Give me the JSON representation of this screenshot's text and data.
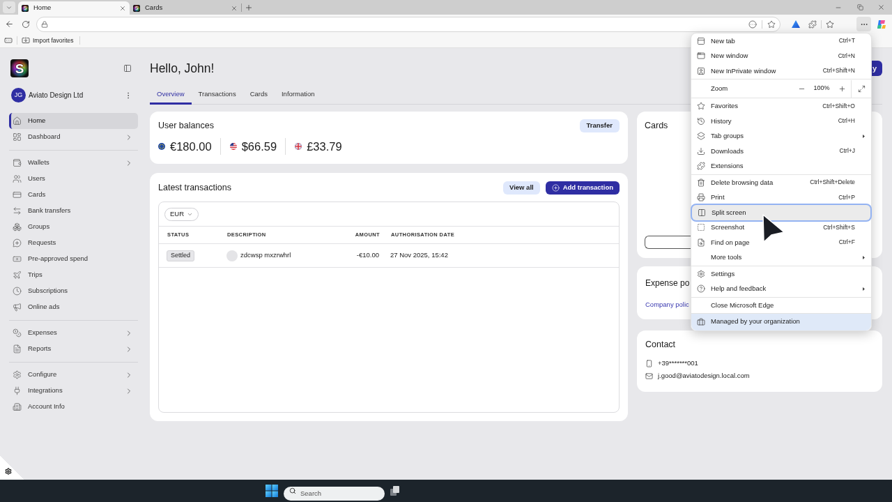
{
  "browser": {
    "tabs": [
      {
        "icon_text": "S",
        "title": "Home",
        "selected": true
      },
      {
        "icon_text": "S",
        "title": "Cards",
        "selected": false
      }
    ],
    "favorites_bar": {
      "items": [
        {
          "label": "Import favorites"
        }
      ]
    },
    "menu": {
      "groups": [
        {
          "items": [
            {
              "kind": "command",
              "label": "New tab",
              "shortcut": "Ctrl+T",
              "submenu": false,
              "highlighted": false
            },
            {
              "kind": "command",
              "label": "New window",
              "shortcut": "Ctrl+N",
              "submenu": false,
              "highlighted": false
            },
            {
              "kind": "command",
              "label": "New InPrivate window",
              "shortcut": "Ctrl+Shift+N",
              "submenu": false,
              "highlighted": false
            }
          ]
        },
        {
          "items": [
            {
              "kind": "zoom",
              "label": "Zoom",
              "value": "100%"
            }
          ]
        },
        {
          "items": [
            {
              "kind": "command",
              "label": "Favorites",
              "shortcut": "Ctrl+Shift+O",
              "submenu": false,
              "highlighted": false
            },
            {
              "kind": "command",
              "label": "History",
              "shortcut": "Ctrl+H",
              "submenu": false,
              "highlighted": false
            },
            {
              "kind": "command",
              "label": "Tab groups",
              "submenu": true,
              "highlighted": false
            },
            {
              "kind": "command",
              "label": "Downloads",
              "shortcut": "Ctrl+J",
              "submenu": false,
              "highlighted": false
            },
            {
              "kind": "command",
              "label": "Extensions",
              "submenu": false,
              "highlighted": false
            }
          ]
        },
        {
          "items": [
            {
              "kind": "command",
              "label": "Delete browsing data",
              "shortcut": "Ctrl+Shift+Delete",
              "submenu": false,
              "highlighted": false
            },
            {
              "kind": "command",
              "label": "Print",
              "shortcut": "Ctrl+P",
              "submenu": false,
              "highlighted": false
            },
            {
              "kind": "command",
              "label": "Split screen",
              "submenu": false,
              "highlighted": true
            },
            {
              "kind": "command",
              "label": "Screenshot",
              "shortcut": "Ctrl+Shift+S",
              "submenu": false,
              "highlighted": false
            },
            {
              "kind": "command",
              "label": "Find on page",
              "shortcut": "Ctrl+F",
              "submenu": false,
              "highlighted": false
            },
            {
              "kind": "command",
              "label": "More tools",
              "submenu": true,
              "highlighted": false
            }
          ]
        },
        {
          "items": [
            {
              "kind": "command",
              "label": "Settings",
              "submenu": false,
              "highlighted": false
            },
            {
              "kind": "command",
              "label": "Help and feedback",
              "submenu": true,
              "highlighted": false
            }
          ]
        },
        {
          "items": [
            {
              "kind": "command",
              "label": "Close Microsoft Edge",
              "submenu": false,
              "highlighted": false
            }
          ]
        },
        {
          "items": [
            {
              "kind": "banner",
              "label": "Managed by your organization"
            }
          ]
        }
      ]
    }
  },
  "sidebar": {
    "logo_text": "S",
    "organization": {
      "initials": "JG",
      "name": "Aviato Design Ltd"
    },
    "groups": [
      {
        "items": [
          {
            "label": "Home",
            "selected": true,
            "has_submenu": false
          },
          {
            "label": "Dashboard",
            "selected": false,
            "has_submenu": true
          }
        ]
      },
      {
        "items": [
          {
            "label": "Wallets",
            "selected": false,
            "has_submenu": true
          },
          {
            "label": "Users",
            "selected": false,
            "has_submenu": false
          },
          {
            "label": "Cards",
            "selected": false,
            "has_submenu": false
          },
          {
            "label": "Bank transfers",
            "selected": false,
            "has_submenu": false
          },
          {
            "label": "Groups",
            "selected": false,
            "has_submenu": false
          },
          {
            "label": "Requests",
            "selected": false,
            "has_submenu": false
          },
          {
            "label": "Pre-approved spend",
            "selected": false,
            "has_submenu": false
          },
          {
            "label": "Trips",
            "selected": false,
            "has_submenu": false
          },
          {
            "label": "Subscriptions",
            "selected": false,
            "has_submenu": false
          },
          {
            "label": "Online ads",
            "selected": false,
            "has_submenu": false
          }
        ]
      },
      {
        "items": [
          {
            "label": "Expenses",
            "selected": false,
            "has_submenu": true
          },
          {
            "label": "Reports",
            "selected": false,
            "has_submenu": true
          }
        ]
      },
      {
        "items": [
          {
            "label": "Configure",
            "selected": false,
            "has_submenu": true
          },
          {
            "label": "Integrations",
            "selected": false,
            "has_submenu": true
          },
          {
            "label": "Account Info",
            "selected": false,
            "has_submenu": false
          }
        ]
      }
    ]
  },
  "header": {
    "title": "Hello, John!",
    "action_button": "y"
  },
  "tabs": [
    {
      "label": "Overview",
      "selected": true
    },
    {
      "label": "Transactions",
      "selected": false
    },
    {
      "label": "Cards",
      "selected": false
    },
    {
      "label": "Information",
      "selected": false
    }
  ],
  "balances": {
    "title": "User balances",
    "button": "Transfer",
    "items": [
      {
        "amount": "€180.00"
      },
      {
        "amount": "$66.59"
      },
      {
        "amount": "£33.79"
      }
    ]
  },
  "transactions": {
    "title": "Latest transactions",
    "view_all": "View all",
    "add": "Add transaction",
    "currency_filter": "EUR",
    "columns": [
      "STATUS",
      "DESCRIPTION",
      "AMOUNT",
      "AUTHORISATION DATE"
    ],
    "rows": [
      {
        "status": "Settled",
        "description": "zdcwsp mxzrwhrl",
        "amount": "-€10.00",
        "date": "27 Nov 2025, 15:42"
      }
    ]
  },
  "cards_panel": {
    "title": "Cards"
  },
  "expense_policy": {
    "title": "Expense po",
    "link": "Company polic"
  },
  "contact": {
    "title": "Contact",
    "phone": "+39*******001",
    "email": "j.good@aviatodesign.local.com"
  },
  "taskbar": {
    "search_placeholder": "Search"
  }
}
